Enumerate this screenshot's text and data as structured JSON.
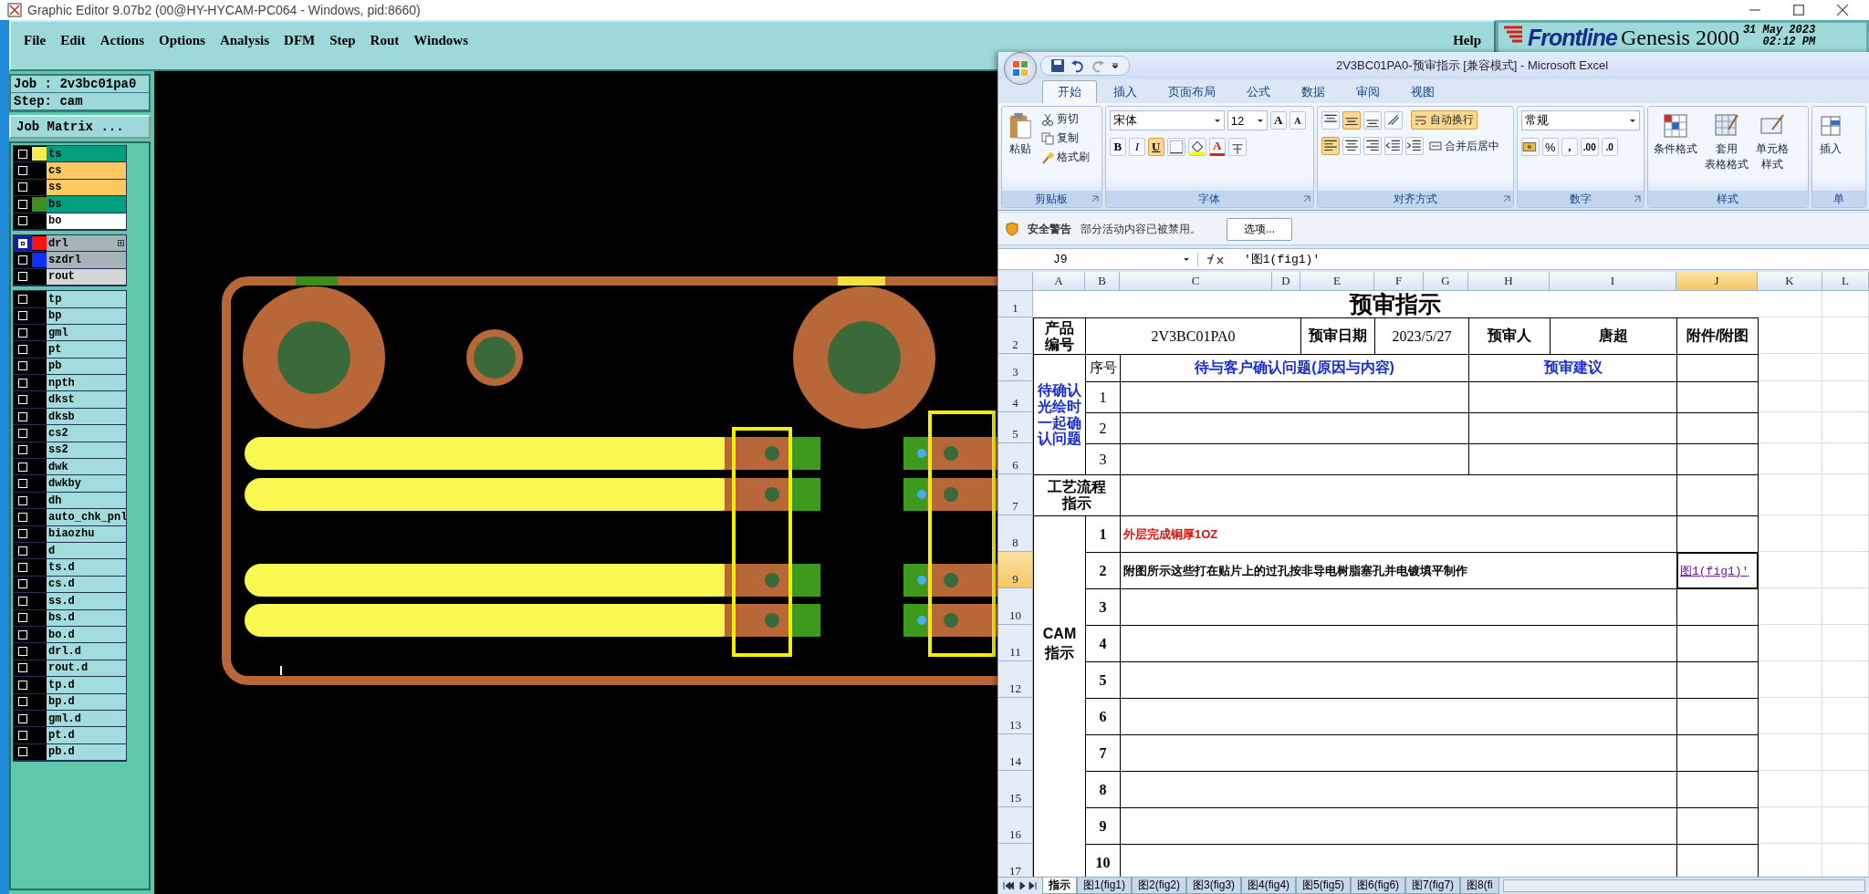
{
  "window": {
    "title": "Graphic Editor 9.07b2 (00@HY-HYCAM-PC064 - Windows, pid:8660)"
  },
  "menu": {
    "items": [
      "File",
      "Edit",
      "Actions",
      "Options",
      "Analysis",
      "DFM",
      "Step",
      "Rout",
      "Windows"
    ],
    "help": "Help"
  },
  "logo": {
    "brand": "Frontline",
    "product": "Genesis 2000",
    "date": "31 May 2023",
    "time": "02:12 PM"
  },
  "job": {
    "job": "Job : 2v3bc01pa0",
    "step": "Step: cam",
    "matrix_button": "Job Matrix ..."
  },
  "layer_groups": [
    {
      "layers": [
        {
          "name": "ts",
          "kind": "mask",
          "color": "#f4ec50",
          "selected": false,
          "marked": false
        },
        {
          "name": "cs",
          "kind": "component",
          "selected": false,
          "marked": false
        },
        {
          "name": "ss",
          "kind": "component",
          "selected": false,
          "marked": false
        },
        {
          "name": "bs",
          "kind": "mask",
          "color": "#3f8f1f",
          "selected": false,
          "marked": false
        },
        {
          "name": "bo",
          "kind": "outline",
          "selected": false,
          "marked": false
        }
      ]
    },
    {
      "layers": [
        {
          "name": "drl",
          "kind": "drill",
          "color": "#ff1010",
          "selected": true,
          "marked": true
        },
        {
          "name": "szdrl",
          "kind": "drill",
          "color": "#1030ff",
          "selected": false,
          "marked": false
        },
        {
          "name": "rout",
          "kind": "rout",
          "selected": false,
          "marked": false
        }
      ]
    },
    {
      "layers": [
        {
          "name": "tp",
          "kind": "misc",
          "selected": false,
          "marked": false
        },
        {
          "name": "bp",
          "kind": "misc",
          "selected": false,
          "marked": false
        },
        {
          "name": "gml",
          "kind": "misc",
          "selected": false,
          "marked": false
        },
        {
          "name": "pt",
          "kind": "misc",
          "selected": false,
          "marked": false
        },
        {
          "name": "pb",
          "kind": "misc",
          "selected": false,
          "marked": false
        },
        {
          "name": "npth",
          "kind": "misc",
          "selected": false,
          "marked": false
        },
        {
          "name": "dkst",
          "kind": "misc",
          "selected": false,
          "marked": false
        },
        {
          "name": "dksb",
          "kind": "misc",
          "selected": false,
          "marked": false
        },
        {
          "name": "cs2",
          "kind": "misc",
          "selected": false,
          "marked": false
        },
        {
          "name": "ss2",
          "kind": "misc",
          "selected": false,
          "marked": false
        },
        {
          "name": "dwk",
          "kind": "misc",
          "selected": false,
          "marked": false
        },
        {
          "name": "dwkby",
          "kind": "misc",
          "selected": false,
          "marked": false
        },
        {
          "name": "dh",
          "kind": "misc",
          "selected": false,
          "marked": false
        },
        {
          "name": "auto_chk_pnl",
          "kind": "misc",
          "selected": false,
          "marked": false
        },
        {
          "name": "biaozhu",
          "kind": "misc",
          "selected": false,
          "marked": false
        },
        {
          "name": "d",
          "kind": "misc",
          "selected": false,
          "marked": false
        },
        {
          "name": "ts.d",
          "kind": "misc",
          "selected": false,
          "marked": false
        },
        {
          "name": "cs.d",
          "kind": "misc",
          "selected": false,
          "marked": false
        },
        {
          "name": "ss.d",
          "kind": "misc",
          "selected": false,
          "marked": false
        },
        {
          "name": "bs.d",
          "kind": "misc",
          "selected": false,
          "marked": false
        },
        {
          "name": "bo.d",
          "kind": "misc",
          "selected": false,
          "marked": false
        },
        {
          "name": "drl.d",
          "kind": "misc",
          "selected": false,
          "marked": false
        },
        {
          "name": "rout.d",
          "kind": "misc",
          "selected": false,
          "marked": false
        },
        {
          "name": "tp.d",
          "kind": "misc",
          "selected": false,
          "marked": false
        },
        {
          "name": "bp.d",
          "kind": "misc",
          "selected": false,
          "marked": false
        },
        {
          "name": "gml.d",
          "kind": "misc",
          "selected": false,
          "marked": false
        },
        {
          "name": "pt.d",
          "kind": "misc",
          "selected": false,
          "marked": false
        },
        {
          "name": "pb.d",
          "kind": "misc",
          "selected": false,
          "marked": false
        }
      ]
    }
  ],
  "excel": {
    "title": "2V3BC01PA0-预审指示  [兼容模式] - Microsoft Excel",
    "tabs": [
      {
        "label": "开始",
        "selected": true
      },
      {
        "label": "插入",
        "selected": false
      },
      {
        "label": "页面布局",
        "selected": false
      },
      {
        "label": "公式",
        "selected": false
      },
      {
        "label": "数据",
        "selected": false
      },
      {
        "label": "审阅",
        "selected": false
      },
      {
        "label": "视图",
        "selected": false
      }
    ],
    "clipboard": {
      "label": "剪贴板",
      "paste": "粘贴",
      "cut": "剪切",
      "copy": "复制",
      "painter": "格式刷"
    },
    "font": {
      "label": "字体",
      "family": "宋体",
      "size": "12",
      "bold": "B",
      "italic": "I",
      "underline": "U",
      "underline_on": true,
      "grow": "A",
      "shrink": "A",
      "color_letter": "A"
    },
    "alignment": {
      "label": "对齐方式",
      "wrap": "自动换行",
      "wrap_on": true,
      "merge": "合并后居中"
    },
    "number": {
      "label": "数字",
      "format": "常规",
      "percent": "%",
      "comma": ",",
      "increase_decimal": ".00",
      "decrease_decimal": ".0"
    },
    "styles": {
      "label": "样式",
      "conditional": "条件格式",
      "table_format": [
        "套用",
        "表格格式"
      ],
      "cell_style": [
        "单元格",
        "样式"
      ]
    },
    "cells": {
      "label": "单",
      "insert": "插入"
    },
    "security": {
      "title": "安全警告",
      "message": "部分活动内容已被禁用。",
      "button": "选项..."
    },
    "name_box": "J9",
    "formula": "'图1(fig1)'",
    "columns": [
      {
        "label": "A",
        "selected": false
      },
      {
        "label": "B",
        "selected": false
      },
      {
        "label": "C",
        "selected": false
      },
      {
        "label": "D",
        "selected": false
      },
      {
        "label": "E",
        "selected": false
      },
      {
        "label": "F",
        "selected": false
      },
      {
        "label": "G",
        "selected": false
      },
      {
        "label": "H",
        "selected": false
      },
      {
        "label": "I",
        "selected": false
      },
      {
        "label": "J",
        "selected": true
      },
      {
        "label": "K",
        "selected": false
      },
      {
        "label": "L",
        "selected": false
      }
    ],
    "rows": [
      {
        "label": "1",
        "selected": false
      },
      {
        "label": "2",
        "selected": false
      },
      {
        "label": "3",
        "selected": false
      },
      {
        "label": "4",
        "selected": false
      },
      {
        "label": "5",
        "selected": false
      },
      {
        "label": "6",
        "selected": false
      },
      {
        "label": "7",
        "selected": false
      },
      {
        "label": "8",
        "selected": false
      },
      {
        "label": "9",
        "selected": true
      },
      {
        "label": "10",
        "selected": false
      },
      {
        "label": "11",
        "selected": false
      },
      {
        "label": "12",
        "selected": false
      },
      {
        "label": "13",
        "selected": false
      },
      {
        "label": "14",
        "selected": false
      },
      {
        "label": "15",
        "selected": false
      },
      {
        "label": "16",
        "selected": false
      },
      {
        "label": "17",
        "selected": false
      }
    ],
    "sheet": {
      "title": "预审指示",
      "product_label": "产品编号",
      "product": "2V3BC01PA0",
      "date_label": "预审日期",
      "date": "2023/5/27",
      "reviewer_label": "预审人",
      "reviewer": "唐超",
      "attachment_label": "附件/附图",
      "confirm_label": "待确认光绘时一起确认问题",
      "seq_label": "序号",
      "question_header": "待与客户确认问题(原因与内容)",
      "suggestion_header": "预审建议",
      "confirm_items": [
        "1",
        "2",
        "3"
      ],
      "process_label": "工艺流程指示",
      "cam_label": [
        "CAM",
        "指示"
      ],
      "cam_items": [
        {
          "no": "1",
          "kind": "warning",
          "text": "外层完成铜厚1OZ",
          "selected": false
        },
        {
          "no": "2",
          "kind": "plain",
          "text": "附图所示这些打在贴片上的过孔按非导电树脂塞孔并电镀填平制作",
          "link": "图1(fig1)'",
          "selected": true
        },
        {
          "no": "3",
          "selected": false
        },
        {
          "no": "4",
          "selected": false
        },
        {
          "no": "5",
          "selected": false
        },
        {
          "no": "6",
          "selected": false
        },
        {
          "no": "7",
          "selected": false
        },
        {
          "no": "8",
          "selected": false
        },
        {
          "no": "9",
          "selected": false
        },
        {
          "no": "10",
          "selected": false
        }
      ]
    },
    "sheet_tabs": [
      {
        "label": "指示",
        "selected": true
      },
      {
        "label": "图1(fig1)",
        "selected": false
      },
      {
        "label": "图2(fig2)",
        "selected": false
      },
      {
        "label": "图3(fig3)",
        "selected": false
      },
      {
        "label": "图4(fig4)",
        "selected": false
      },
      {
        "label": "图5(fig5)",
        "selected": false
      },
      {
        "label": "图6(fig6)",
        "selected": false
      },
      {
        "label": "图7(fig7)",
        "selected": false
      },
      {
        "label": "图8(fi",
        "selected": false
      }
    ]
  }
}
